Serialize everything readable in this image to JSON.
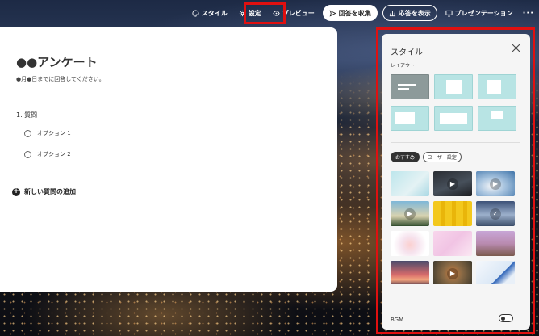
{
  "toolbar": {
    "style_label": "スタイル",
    "settings_label": "設定",
    "preview_label": "プレビュー",
    "collect_label": "回答を収集",
    "responses_label": "応答を表示",
    "present_label": "プレゼンテーション",
    "more_label": "···"
  },
  "form": {
    "title": "●●アンケート",
    "description": "●月●日までに回答してください。",
    "question_title": "1. 質問",
    "options": [
      "オプション 1",
      "オプション 2"
    ],
    "add_question_label": "新しい質問の追加"
  },
  "style_panel": {
    "title": "スタイル",
    "layout_label": "レイアウト",
    "tabs": [
      "おすすめ",
      "ユーザー設定"
    ],
    "active_tab": "おすすめ",
    "bgm_label": "BGM",
    "bgm_on": false
  },
  "colors": {
    "highlight": "#e01010",
    "layout_tile": "#b8e4e4",
    "layout_selected": "#8d9a9a"
  }
}
